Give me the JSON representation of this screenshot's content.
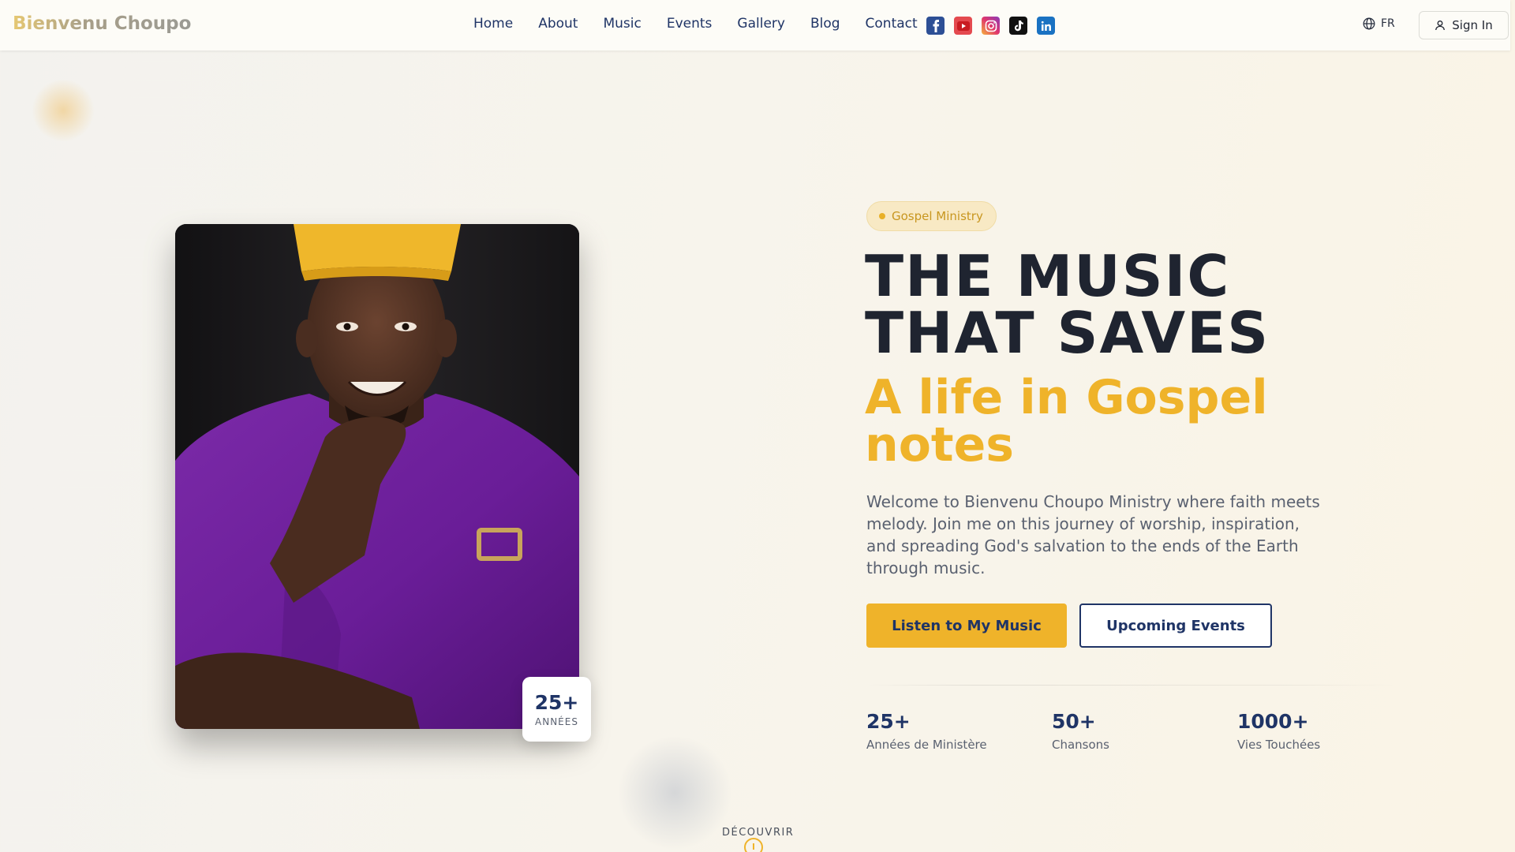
{
  "header": {
    "logo": "Bienvenu Choupo",
    "nav": [
      "Home",
      "About",
      "Music",
      "Events",
      "Gallery",
      "Blog",
      "Contact"
    ],
    "socials": [
      "facebook-icon",
      "youtube-icon",
      "instagram-icon",
      "tiktok-icon",
      "linkedin-icon"
    ],
    "language": "FR",
    "sign_in": "Sign In"
  },
  "hero": {
    "badge": "Gospel Ministry",
    "title_line1": "THE MUSIC",
    "title_line2": "THAT SAVES",
    "subtitle_line1": "A life in Gospel",
    "subtitle_line2": "notes",
    "description": "Welcome to Bienvenu Choupo Ministry where faith meets melody. Join me on this journey of worship, inspiration, and spreading God's salvation to the ends of the Earth through music.",
    "primary_button": "Listen to My Music",
    "secondary_button": "Upcoming Events"
  },
  "photo_badge": {
    "value": "25+",
    "label": "ANNÉES"
  },
  "stats": [
    {
      "value": "25+",
      "label": "Années de Ministère"
    },
    {
      "value": "50+",
      "label": "Chansons"
    },
    {
      "value": "1000+",
      "label": "Vies Touchées"
    }
  ],
  "scroll": {
    "label": "DÉCOUVRIR"
  },
  "colors": {
    "accent": "#efb32a",
    "navy": "#1f3466",
    "dark_text": "#1f2430",
    "body_text": "#5a6170"
  }
}
